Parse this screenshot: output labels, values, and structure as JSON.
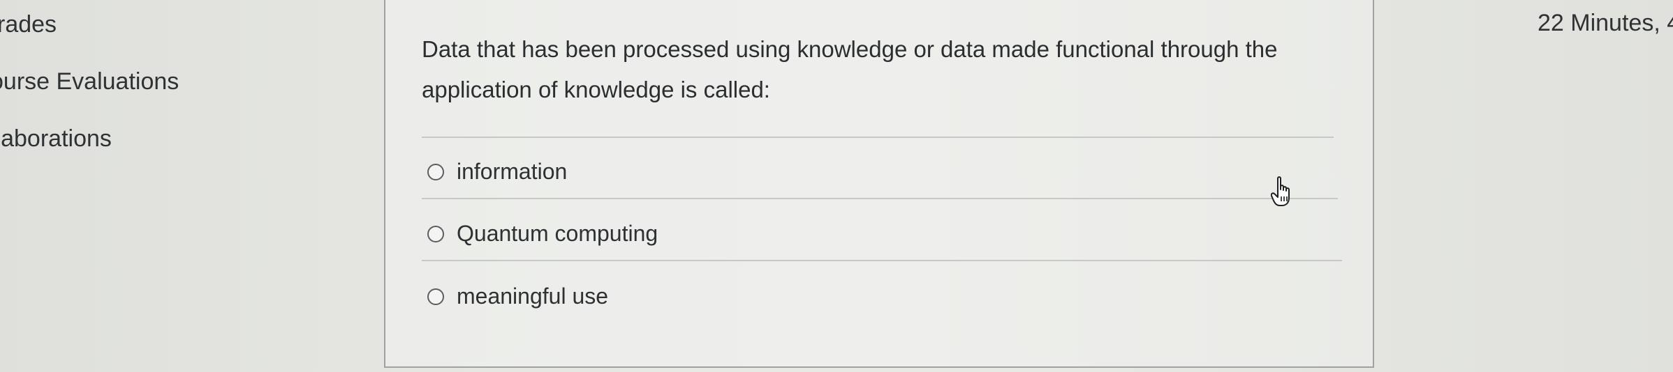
{
  "course_nav": {
    "items": [
      {
        "label": "rades"
      },
      {
        "label": "ourse Evaluations"
      },
      {
        "label": "llaborations"
      }
    ]
  },
  "question": {
    "line1": "Data that has been processed using knowledge or data made functional through the",
    "line2": "application of knowledge is called:",
    "answers": [
      {
        "label": "information"
      },
      {
        "label": "Quantum computing"
      },
      {
        "label": "meaningful use"
      }
    ]
  },
  "timer": {
    "text": "22 Minutes, 4"
  },
  "icons": {
    "cursor": "hand-pointer-icon",
    "radio": "radio-button"
  }
}
